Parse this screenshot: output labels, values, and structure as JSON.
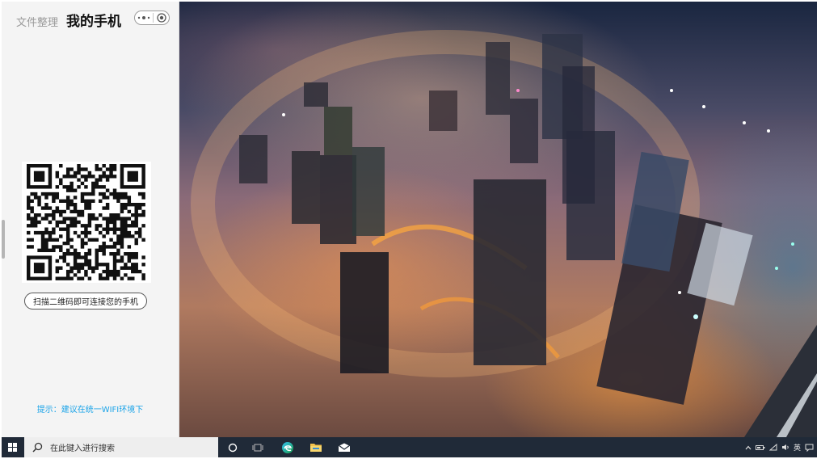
{
  "panel": {
    "tab_files": "文件整理",
    "tab_phone": "我的手机",
    "scan_button": "扫描二维码即可连接您的手机",
    "tip": "提示：建议在统一WIFI环境下"
  },
  "taskbar": {
    "search_placeholder": "在此键入进行搜索",
    "language": "英"
  },
  "colors": {
    "panel_bg": "#f4f4f4",
    "tip_color": "#1aa3e8",
    "taskbar_bg": "#202a38"
  },
  "icons": {
    "capsule_more": "more-dots-icon",
    "capsule_close": "target-close-icon",
    "start": "windows-logo-icon",
    "search": "search-icon",
    "cortana": "cortana-circle-icon",
    "task_view": "task-view-icon",
    "edge": "edge-browser-icon",
    "explorer": "file-explorer-icon",
    "mail": "mail-icon"
  }
}
